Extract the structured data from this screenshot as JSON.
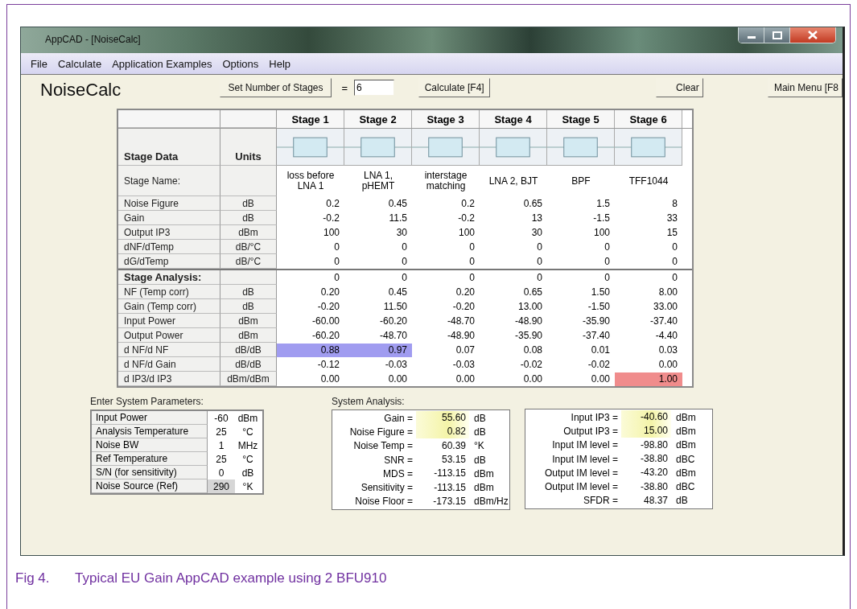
{
  "window": {
    "title": "AppCAD - [NoiseCalc]"
  },
  "menu": [
    "File",
    "Calculate",
    "Application Examples",
    "Options",
    "Help"
  ],
  "toolbar": {
    "heading": "NoiseCalc",
    "set_stages_button": "Set Number of Stages",
    "equals": "=",
    "stages_field": "6",
    "calculate_button": "Calculate [F4]",
    "clear_button": "Clear",
    "main_menu_button": "Main Menu [F8"
  },
  "stage_table": {
    "label_heading": "Stage Data",
    "units_heading": "Units",
    "name_label": "Stage Name:",
    "stages": [
      {
        "title": "Stage 1",
        "name": "loss before LNA 1"
      },
      {
        "title": "Stage 2",
        "name": "LNA 1, pHEMT"
      },
      {
        "title": "Stage 3",
        "name": "interstage matching"
      },
      {
        "title": "Stage 4",
        "name": "LNA 2, BJT"
      },
      {
        "title": "Stage 5",
        "name": "BPF"
      },
      {
        "title": "Stage 6",
        "name": "TFF1044"
      }
    ],
    "input_rows": [
      {
        "label": "Noise Figure",
        "unit": "dB",
        "cells": [
          "0.2",
          "0.45",
          "0.2",
          "0.65",
          "1.5",
          "8"
        ]
      },
      {
        "label": "Gain",
        "unit": "dB",
        "cells": [
          "-0.2",
          "11.5",
          "-0.2",
          "13",
          "-1.5",
          "33"
        ]
      },
      {
        "label": "Output IP3",
        "unit": "dBm",
        "cells": [
          "100",
          "30",
          "100",
          "30",
          "100",
          "15"
        ]
      },
      {
        "label": "dNF/dTemp",
        "unit": "dB/°C",
        "cells": [
          "0",
          "0",
          "0",
          "0",
          "0",
          "0"
        ]
      },
      {
        "label": "dG/dTemp",
        "unit": "dB/°C",
        "cells": [
          "0",
          "0",
          "0",
          "0",
          "0",
          "0"
        ]
      }
    ],
    "analysis_rows": [
      {
        "kind": "heading",
        "label": "Stage Analysis:",
        "cells": [
          "0",
          "0",
          "0",
          "0",
          "0",
          "0"
        ]
      },
      {
        "kind": "value",
        "label": "NF (Temp corr)",
        "unit": "dB",
        "cells": [
          "0.20",
          "0.45",
          "0.20",
          "0.65",
          "1.50",
          "8.00"
        ]
      },
      {
        "kind": "value",
        "label": "Gain (Temp corr)",
        "unit": "dB",
        "cells": [
          "-0.20",
          "11.50",
          "-0.20",
          "13.00",
          "-1.50",
          "33.00"
        ]
      },
      {
        "kind": "value",
        "label": "Input Power",
        "unit": "dBm",
        "cells": [
          "-60.00",
          "-60.20",
          "-48.70",
          "-48.90",
          "-35.90",
          "-37.40"
        ]
      },
      {
        "kind": "value",
        "label": "Output Power",
        "unit": "dBm",
        "cells": [
          "-60.20",
          "-48.70",
          "-48.90",
          "-35.90",
          "-37.40",
          "-4.40"
        ]
      },
      {
        "kind": "value",
        "label": "d NF/d NF",
        "unit": "dB/dB",
        "cells": [
          {
            "value": "0.88",
            "color": "#a09cf0"
          },
          {
            "value": "0.97",
            "color": "#a09cf0"
          },
          "0.07",
          "0.08",
          "0.01",
          "0.03"
        ]
      },
      {
        "kind": "value",
        "label": "d NF/d Gain",
        "unit": "dB/dB",
        "cells": [
          "-0.12",
          "-0.03",
          "-0.03",
          "-0.02",
          "-0.02",
          "0.00"
        ]
      },
      {
        "kind": "value",
        "label": "d IP3/d IP3",
        "unit": "dBm/dBm",
        "cells": [
          "0.00",
          "0.00",
          "0.00",
          "0.00",
          "0.00",
          {
            "value": "1.00",
            "color": "#f08c8c"
          }
        ]
      }
    ]
  },
  "system_parameters": {
    "title": "Enter System Parameters:",
    "rows": [
      {
        "label": "Input Power",
        "value": "-60",
        "unit": "dBm",
        "disabled": false
      },
      {
        "label": "Analysis Temperature",
        "value": "25",
        "unit": "°C",
        "disabled": false
      },
      {
        "label": "Noise BW",
        "value": "1",
        "unit": "MHz",
        "disabled": false
      },
      {
        "label": "Ref Temperature",
        "value": "25",
        "unit": "°C",
        "disabled": false
      },
      {
        "label": "S/N (for sensitivity)",
        "value": "0",
        "unit": "dB",
        "disabled": false
      },
      {
        "label": "Noise Source (Ref)",
        "value": "290",
        "unit": "°K",
        "disabled": true
      }
    ]
  },
  "system_analysis": {
    "title": "System Analysis:",
    "left": [
      {
        "label": "Gain =",
        "value": "55.60",
        "unit": "dB",
        "highlighted": true
      },
      {
        "label": "Noise Figure =",
        "value": "0.82",
        "unit": "dB",
        "highlighted": true
      },
      {
        "label": "Noise Temp =",
        "value": "60.39",
        "unit": "°K",
        "highlighted": false
      },
      {
        "label": "SNR =",
        "value": "53.15",
        "unit": "dB",
        "highlighted": false
      },
      {
        "label": "MDS =",
        "value": "-113.15",
        "unit": "dBm",
        "highlighted": false
      },
      {
        "label": "Sensitivity =",
        "value": "-113.15",
        "unit": "dBm",
        "highlighted": false
      },
      {
        "label": "Noise Floor =",
        "value": "-173.15",
        "unit": "dBm/Hz",
        "highlighted": false
      }
    ],
    "right": [
      {
        "label": "Input IP3 =",
        "value": "-40.60",
        "unit": "dBm",
        "highlighted": true
      },
      {
        "label": "Output IP3 =",
        "value": "15.00",
        "unit": "dBm",
        "highlighted": true
      },
      {
        "label": "Input IM level =",
        "value": "-98.80",
        "unit": "dBm",
        "highlighted": false
      },
      {
        "label": "Input IM level =",
        "value": "-38.80",
        "unit": "dBC",
        "highlighted": false
      },
      {
        "label": "Output IM level =",
        "value": "-43.20",
        "unit": "dBm",
        "highlighted": false
      },
      {
        "label": "Output IM level =",
        "value": "-38.80",
        "unit": "dBC",
        "highlighted": false
      },
      {
        "label": "SFDR =",
        "value": "48.37",
        "unit": "dB",
        "highlighted": false
      }
    ]
  },
  "caption": {
    "number": "Fig 4.",
    "text": "Typical EU Gain AppCAD example using 2 BFU910"
  }
}
